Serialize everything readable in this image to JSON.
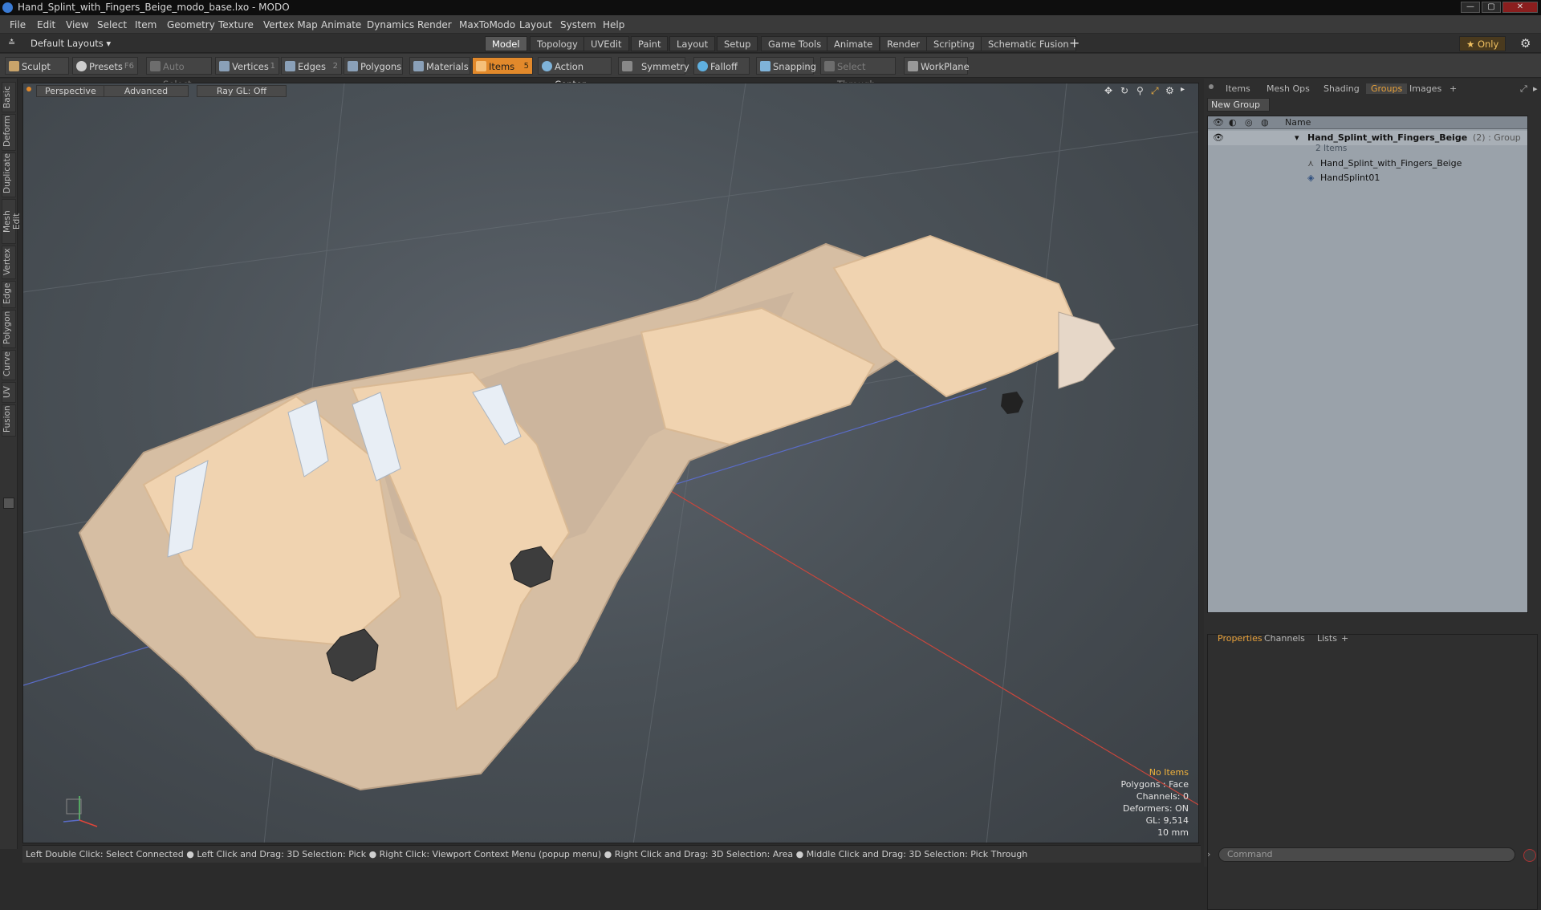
{
  "window": {
    "title": "Hand_Splint_with_Fingers_Beige_modo_base.lxo - MODO",
    "buttons": [
      "—",
      "▢",
      "✕"
    ]
  },
  "menu": [
    "File",
    "Edit",
    "View",
    "Select",
    "Item",
    "Geometry",
    "Texture",
    "Vertex Map",
    "Animate",
    "Dynamics",
    "Render",
    "MaxToModo",
    "Layout",
    "System",
    "Help"
  ],
  "layouts": {
    "label": "Default Layouts ▾",
    "only_label": "★ Only",
    "gear": "⚙",
    "add": "+"
  },
  "tabs": [
    "Model",
    "Topology",
    "UVEdit",
    "Paint",
    "Layout",
    "Setup",
    "Game Tools",
    "Animate",
    "Render",
    "Scripting",
    "Schematic Fusion"
  ],
  "active_tab": "Model",
  "toolbar": {
    "sculpt": "Sculpt",
    "presets": "Presets",
    "presets_key": "F6",
    "auto_select": "Auto Select",
    "vertices": "Vertices",
    "vertices_key": "1",
    "edges": "Edges",
    "edges_key": "2",
    "polygons": "Polygons",
    "materials": "Materials",
    "items": "Items",
    "items_key": "5",
    "action_center": "Action Center",
    "symmetry": "Symmetry",
    "falloff": "Falloff",
    "snapping": "Snapping",
    "select_through": "Select Through",
    "workplane": "WorkPlane"
  },
  "left_tabs": [
    "Basic",
    "Deform",
    "Duplicate",
    "Mesh Edit",
    "Vertex",
    "Edge",
    "Polygon",
    "Curve",
    "UV",
    "Fusion"
  ],
  "viewport": {
    "perspective": "Perspective",
    "advanced": "Advanced",
    "raygl": "Ray GL: Off",
    "hud": {
      "no_items": "No Items",
      "polygons": "Polygons : Face",
      "channels": "Channels: 0",
      "deformers": "Deformers: ON",
      "gl": "GL: 9,514",
      "units": "10 mm"
    }
  },
  "status": "Left Double Click: Select Connected ● Left Click and Drag: 3D Selection: Pick ● Right Click: Viewport Context Menu (popup menu) ● Right Click and Drag: 3D Selection: Area ● Middle Click and Drag: 3D Selection: Pick Through",
  "right_panel": {
    "tabs": [
      "Items",
      "Mesh Ops",
      "Shading",
      "Groups",
      "Images"
    ],
    "active_tab": "Groups",
    "new_group": "New Group",
    "col_name": "Name",
    "group": {
      "name": "Hand_Splint_with_Fingers_Beige",
      "meta": "(2) : Group",
      "count": "2 Items"
    },
    "children": [
      "Hand_Splint_with_Fingers_Beige",
      "HandSplint01"
    ],
    "bottom_tabs": [
      "Properties",
      "Channels",
      "Lists"
    ],
    "bottom_active": "Properties",
    "command_placeholder": "Command"
  },
  "colors": {
    "accent": "#e2892b",
    "splint_strap": "#f0d3b0",
    "splint_base": "#d9bfa1",
    "panel_bg": "#9aa2aa"
  }
}
